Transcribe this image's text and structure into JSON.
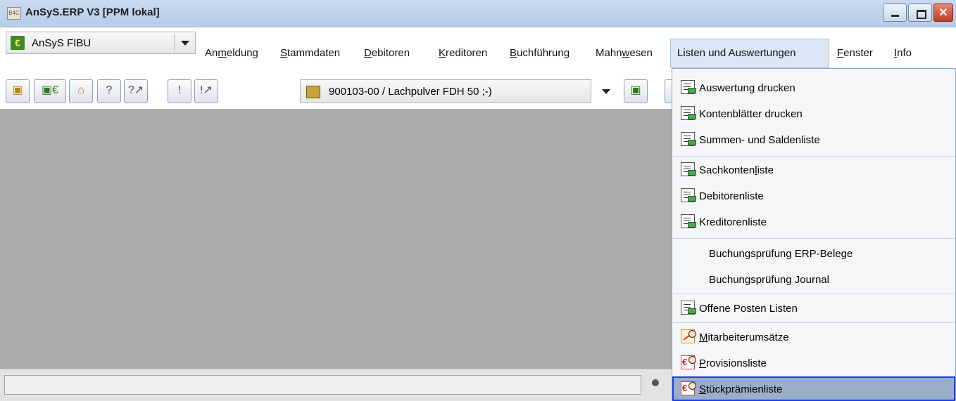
{
  "window": {
    "app_icon_text": "B4C",
    "title": "AnSyS.ERP V3  [PPM lokal]",
    "close_glyph": "✕"
  },
  "module_selector": {
    "value": "AnSyS FIBU",
    "icon": "euro-icon"
  },
  "menu": {
    "anmeldung": {
      "pre": "An",
      "accel": "m",
      "post": "eldung"
    },
    "stammdaten": {
      "pre": "",
      "accel": "S",
      "post": "tammdaten"
    },
    "debitoren": {
      "pre": "",
      "accel": "D",
      "post": "ebitoren"
    },
    "kreditoren": {
      "pre": "",
      "accel": "K",
      "post": "reditoren"
    },
    "buchfuehrung": {
      "pre": "",
      "accel": "B",
      "post": "uchführung"
    },
    "mahnwesen": {
      "pre": "Mahn",
      "accel": "w",
      "post": "esen"
    },
    "listen": {
      "label": "Listen und Auswertungen"
    },
    "fenster": {
      "pre": "",
      "accel": "F",
      "post": "enster"
    },
    "info": {
      "pre": "",
      "accel": "I",
      "post": "nfo"
    }
  },
  "toolbar": {
    "icons": [
      "cube-icon",
      "cube-euro-icon",
      "home-icon",
      "help-icon",
      "help-arrow-icon",
      "info-icon",
      "info-arrow-icon"
    ],
    "record_value": "900103-00 / Lachpulver FDH 50 ;-)"
  },
  "dropdown": {
    "items": [
      {
        "label": "Auswertung drucken",
        "icon": "list-print-icon"
      },
      {
        "label": "Kontenblätter drucken",
        "icon": "list-print-icon"
      },
      {
        "label": "Summen- und Saldenliste",
        "icon": "list-print-icon"
      },
      {
        "label": "Sachkontenliste",
        "pre": "Sachkonten",
        "accel": "l",
        "post": "iste",
        "icon": "list-print-icon"
      },
      {
        "label": "Debitorenliste",
        "icon": "list-print-icon"
      },
      {
        "label": "Kreditorenliste",
        "icon": "list-print-icon"
      },
      {
        "label": "Buchungsprüfung ERP-Belege",
        "icon": ""
      },
      {
        "label": "Buchungsprüfung Journal",
        "icon": ""
      },
      {
        "label": "Offene Posten Listen",
        "icon": "list-print-icon"
      },
      {
        "label": "Mitarbeiterumsätze",
        "pre": "",
        "accel": "M",
        "post": "itarbeiterumsätze",
        "icon": "sales-chart-icon"
      },
      {
        "label": "Provisionsliste",
        "pre": "",
        "accel": "P",
        "post": "rovisionsliste",
        "icon": "euro-person-icon"
      },
      {
        "label": "Stückprämienliste",
        "pre": "",
        "accel": "S",
        "post": "tückprämienliste",
        "icon": "euro-person-icon"
      }
    ]
  },
  "status": {
    "text": ""
  }
}
